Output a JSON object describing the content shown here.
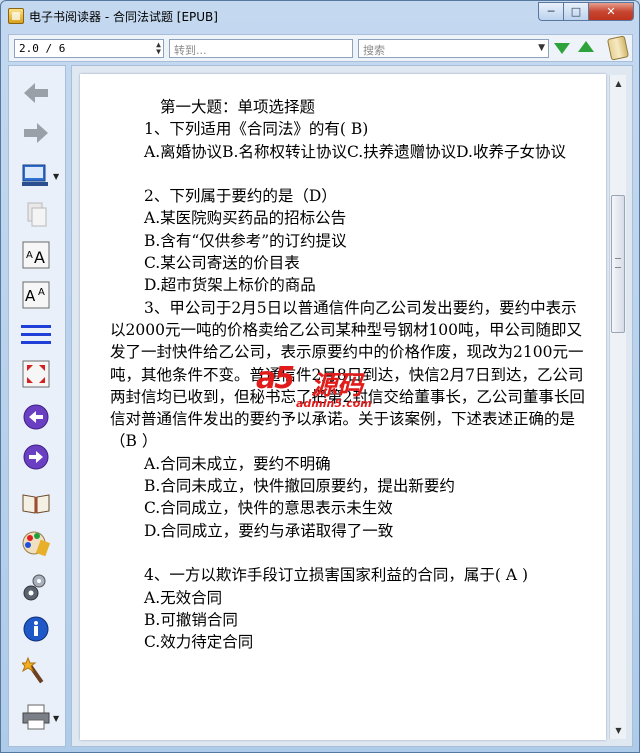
{
  "window": {
    "title": "电子书阅读器 - 合同法试题 [EPUB]"
  },
  "toolbar": {
    "page_value": "2.0 / 6",
    "goto_placeholder": "转到...",
    "search_placeholder": "搜索"
  },
  "content": {
    "lines": [
      "第一大题：单项选择题",
      "1、下列适用《合同法》的有( B)",
      "A.离婚协议B.名称权转让协议C.扶养遗赠协议D.收养子女协议",
      "",
      "2、下列属于要约的是（D）",
      "A.某医院购买药品的招标公告",
      "B.含有“仅供参考”的订约提议",
      "C.某公司寄送的价目表",
      "D.超市货架上标价的商品",
      "3、甲公司于2月5日以普通信件向乙公司发出要约，要约中表示以2000元一吨的价格卖给乙公司某种型号钢材100吨，甲公司随即又发了一封快件给乙公司，表示原要约中的价格作废，现改为2100元一吨，其他条件不变。普通信件2月8日到达，快信2月7日到达，乙公司两封信均已收到，但秘书忘了把第2封信交给董事长，乙公司董事长回信对普通信件发出的要约予以承诺。关于该案例，下述表述正确的是（B ）",
      "A.合同未成立，要约不明确",
      "B.合同未成立，快件撤回原要约，提出新要约",
      "C.合同成立，快件的意思表示未生效",
      "D.合同成立，要约与承诺取得了一致",
      "",
      "4、一方以欺诈手段订立损害国家利益的合同，属于( A )",
      "A.无效合同",
      "B.可撤销合同",
      "C.效力待定合同"
    ]
  },
  "watermark": {
    "logo": "a5",
    "name": "源码",
    "url": "admin5.com"
  },
  "colors": {
    "accent_green": "#2ea33b",
    "watermark_red": "#e21b1b",
    "close_red": "#c74632"
  }
}
